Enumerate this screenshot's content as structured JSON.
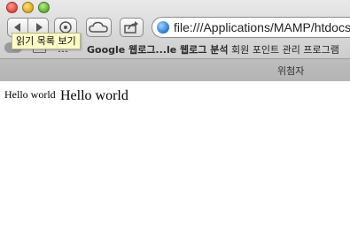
{
  "toolbar": {
    "address": "file:///Applications/MAMP/htdocs"
  },
  "tooltip": {
    "text": "읽기 목록 보기"
  },
  "bookmarks": {
    "items": [
      "Google 웹로그...le 웹로그 분석",
      "회원 포인트 관리 프로그램"
    ]
  },
  "tab": {
    "title": "위첨자"
  },
  "page": {
    "text_small": "Hello world",
    "text_large": "Hello world"
  },
  "colors": {
    "tooltip_bg": "#fbfbc6",
    "close": "#e0453a",
    "minimize": "#e2a51c",
    "zoom": "#5fae2f"
  }
}
